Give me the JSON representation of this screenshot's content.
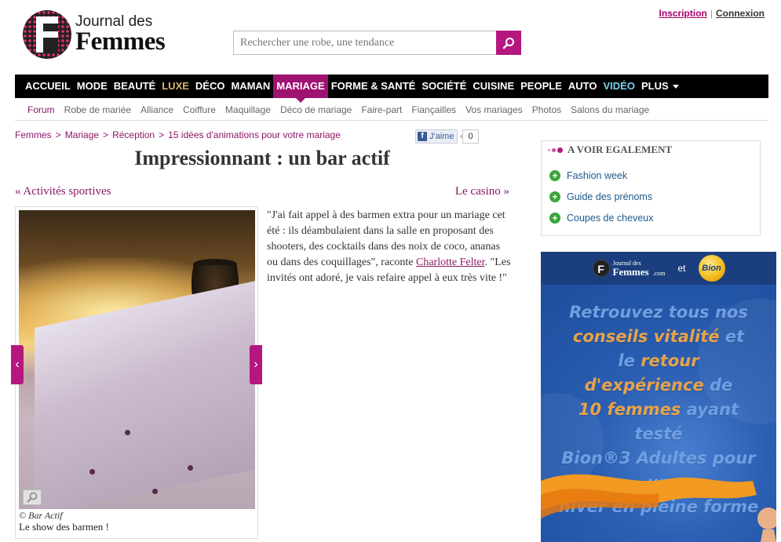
{
  "header": {
    "logo_sub": "Journal des",
    "logo_main": "Femmes",
    "inscription": "Inscription",
    "connexion": "Connexion",
    "search_placeholder": "Rechercher une robe, une tendance"
  },
  "mainnav": [
    "ACCUEIL",
    "MODE",
    "BEAUTÉ",
    "LUXE",
    "DÉCO",
    "MAMAN",
    "MARIAGE",
    "FORME & SANTÉ",
    "SOCIÉTÉ",
    "CUISINE",
    "PEOPLE",
    "AUTO",
    "VIDÉO",
    "PLUS"
  ],
  "subnav": [
    "Forum",
    "Robe de mariée",
    "Alliance",
    "Coiffure",
    "Maquillage",
    "Déco de mariage",
    "Faire-part",
    "Fiançailles",
    "Vos mariages",
    "Photos",
    "Salons du mariage"
  ],
  "breadcrumb": [
    "Femmes",
    "Mariage",
    "Réception",
    "15 idées d'animations pour votre mariage"
  ],
  "like": {
    "label": "J'aime",
    "count": "0"
  },
  "article": {
    "title": "Impressionnant : un bar actif",
    "prev": "« Activités sportives",
    "next": "Le casino »",
    "quote_before": "\"J'ai fait appel à des barmen extra pour un mariage cet été : ils déambulaient dans la salle en proposant des shooters, des cocktails dans des noix de coco, ananas ou dans des coquillages\", raconte ",
    "quote_link": "Charlotte Felter",
    "quote_after": ". \"Les invités ont adoré, je vais refaire appel à eux très vite !\"",
    "photo_credit": "© Bar Actif",
    "photo_caption": "Le show des barmen !"
  },
  "sidebar": {
    "also_title": "A VOIR EGALEMENT",
    "also_items": [
      "Fashion week",
      "Guide des prénoms",
      "Coupes de cheveux"
    ]
  },
  "ad": {
    "logo_sub": "Journal des",
    "logo_main": "Femmes",
    "logo_dom": ".com",
    "et": "et",
    "brand": "Bion",
    "line1": "Retrouvez tous nos",
    "line2a": "conseils vitalité",
    "line2b": " et",
    "line3a": "le ",
    "line3b": "retour d'expérience",
    "line3c": " de",
    "line4a": "10 femmes",
    "line4b": " ayant testé",
    "line5": "Bion®3 Adultes pour un",
    "line6": "hiver en pleine forme"
  },
  "colors": {
    "brand": "#9e1270",
    "accent": "#b5177f",
    "link": "#8c1768",
    "luxe": "#d7b66c",
    "video": "#7ad1f2"
  }
}
